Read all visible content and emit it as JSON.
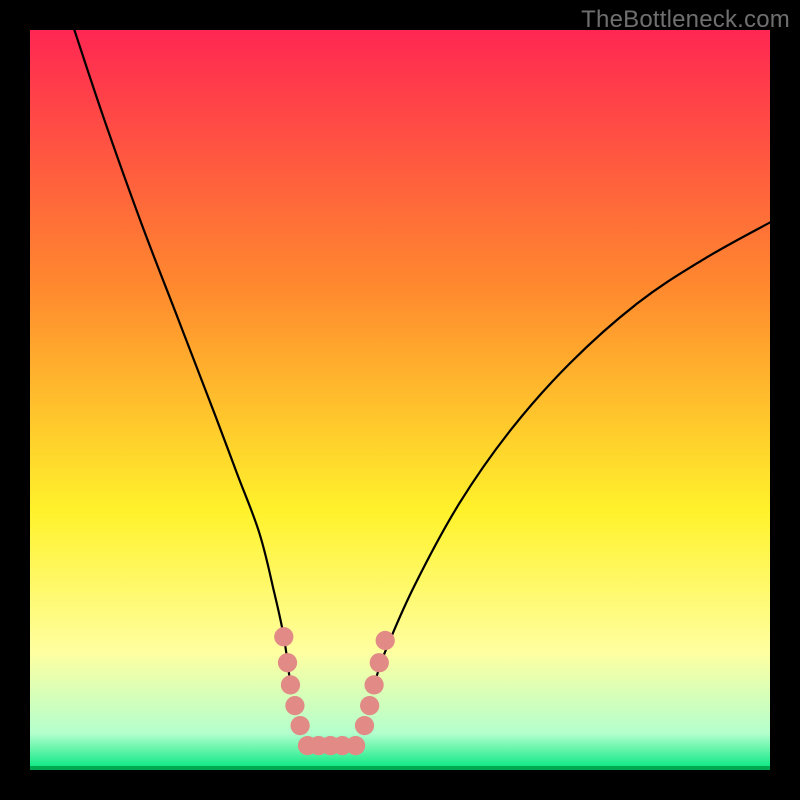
{
  "watermark": "TheBottleneck.com",
  "chart_data": {
    "type": "line",
    "xlim": [
      0,
      100
    ],
    "ylim": [
      0,
      100
    ],
    "xlabel": "",
    "ylabel": "",
    "title": "",
    "background_gradient": {
      "top": "#ff2752",
      "mid1": "#ff8a2e",
      "mid2": "#fff22b",
      "low": "#ffffa0",
      "bottom_band": "#00e77f",
      "bottom_line": "#00a850"
    },
    "curves": {
      "left": [
        {
          "x": 6.0,
          "y": 100.0
        },
        {
          "x": 10.0,
          "y": 88.0
        },
        {
          "x": 15.0,
          "y": 74.0
        },
        {
          "x": 20.0,
          "y": 61.0
        },
        {
          "x": 25.0,
          "y": 48.0
        },
        {
          "x": 28.0,
          "y": 40.0
        },
        {
          "x": 31.0,
          "y": 32.0
        },
        {
          "x": 33.0,
          "y": 24.0
        },
        {
          "x": 34.3,
          "y": 18.0
        },
        {
          "x": 35.2,
          "y": 11.5
        }
      ],
      "right": [
        {
          "x": 46.5,
          "y": 11.5
        },
        {
          "x": 48.0,
          "y": 16.0
        },
        {
          "x": 52.0,
          "y": 25.0
        },
        {
          "x": 58.0,
          "y": 36.0
        },
        {
          "x": 65.0,
          "y": 46.0
        },
        {
          "x": 73.0,
          "y": 55.0
        },
        {
          "x": 82.0,
          "y": 63.0
        },
        {
          "x": 91.0,
          "y": 69.0
        },
        {
          "x": 100.0,
          "y": 74.0
        }
      ],
      "bottom_flat": [
        {
          "x": 37.5,
          "y": 3.3
        },
        {
          "x": 44.0,
          "y": 3.3
        }
      ]
    },
    "markers": {
      "color": "#e18a86",
      "radius_data_units": 1.3,
      "left_end": [
        {
          "x": 34.3,
          "y": 18.0
        },
        {
          "x": 34.8,
          "y": 14.5
        },
        {
          "x": 35.2,
          "y": 11.5
        },
        {
          "x": 35.8,
          "y": 8.7
        },
        {
          "x": 36.5,
          "y": 6.0
        }
      ],
      "bottom": [
        {
          "x": 37.5,
          "y": 3.3
        },
        {
          "x": 39.0,
          "y": 3.3
        },
        {
          "x": 40.6,
          "y": 3.3
        },
        {
          "x": 42.2,
          "y": 3.3
        },
        {
          "x": 44.0,
          "y": 3.3
        }
      ],
      "right_start": [
        {
          "x": 45.2,
          "y": 6.0
        },
        {
          "x": 45.9,
          "y": 8.7
        },
        {
          "x": 46.5,
          "y": 11.5
        },
        {
          "x": 47.2,
          "y": 14.5
        },
        {
          "x": 48.0,
          "y": 17.5
        }
      ]
    }
  }
}
